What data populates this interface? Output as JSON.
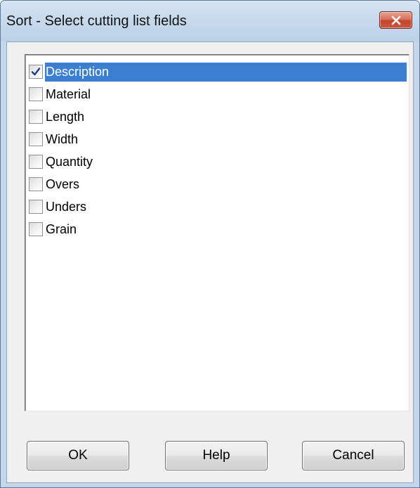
{
  "window": {
    "title": "Sort - Select cutting list fields",
    "close_icon": "close-x-icon"
  },
  "fields_list": {
    "items": [
      {
        "label": "Description",
        "checked": true,
        "selected": true
      },
      {
        "label": "Material",
        "checked": false,
        "selected": false
      },
      {
        "label": "Length",
        "checked": false,
        "selected": false
      },
      {
        "label": "Width",
        "checked": false,
        "selected": false
      },
      {
        "label": "Quantity",
        "checked": false,
        "selected": false
      },
      {
        "label": "Overs",
        "checked": false,
        "selected": false
      },
      {
        "label": "Unders",
        "checked": false,
        "selected": false
      },
      {
        "label": "Grain",
        "checked": false,
        "selected": false
      }
    ]
  },
  "buttons": {
    "ok_label": "OK",
    "help_label": "Help",
    "cancel_label": "Cancel"
  },
  "colors": {
    "selection": "#3c7fd1",
    "titlebar": "#c4d7ea",
    "close_button": "#c5442c",
    "dialog_background": "#f0f0f0"
  }
}
